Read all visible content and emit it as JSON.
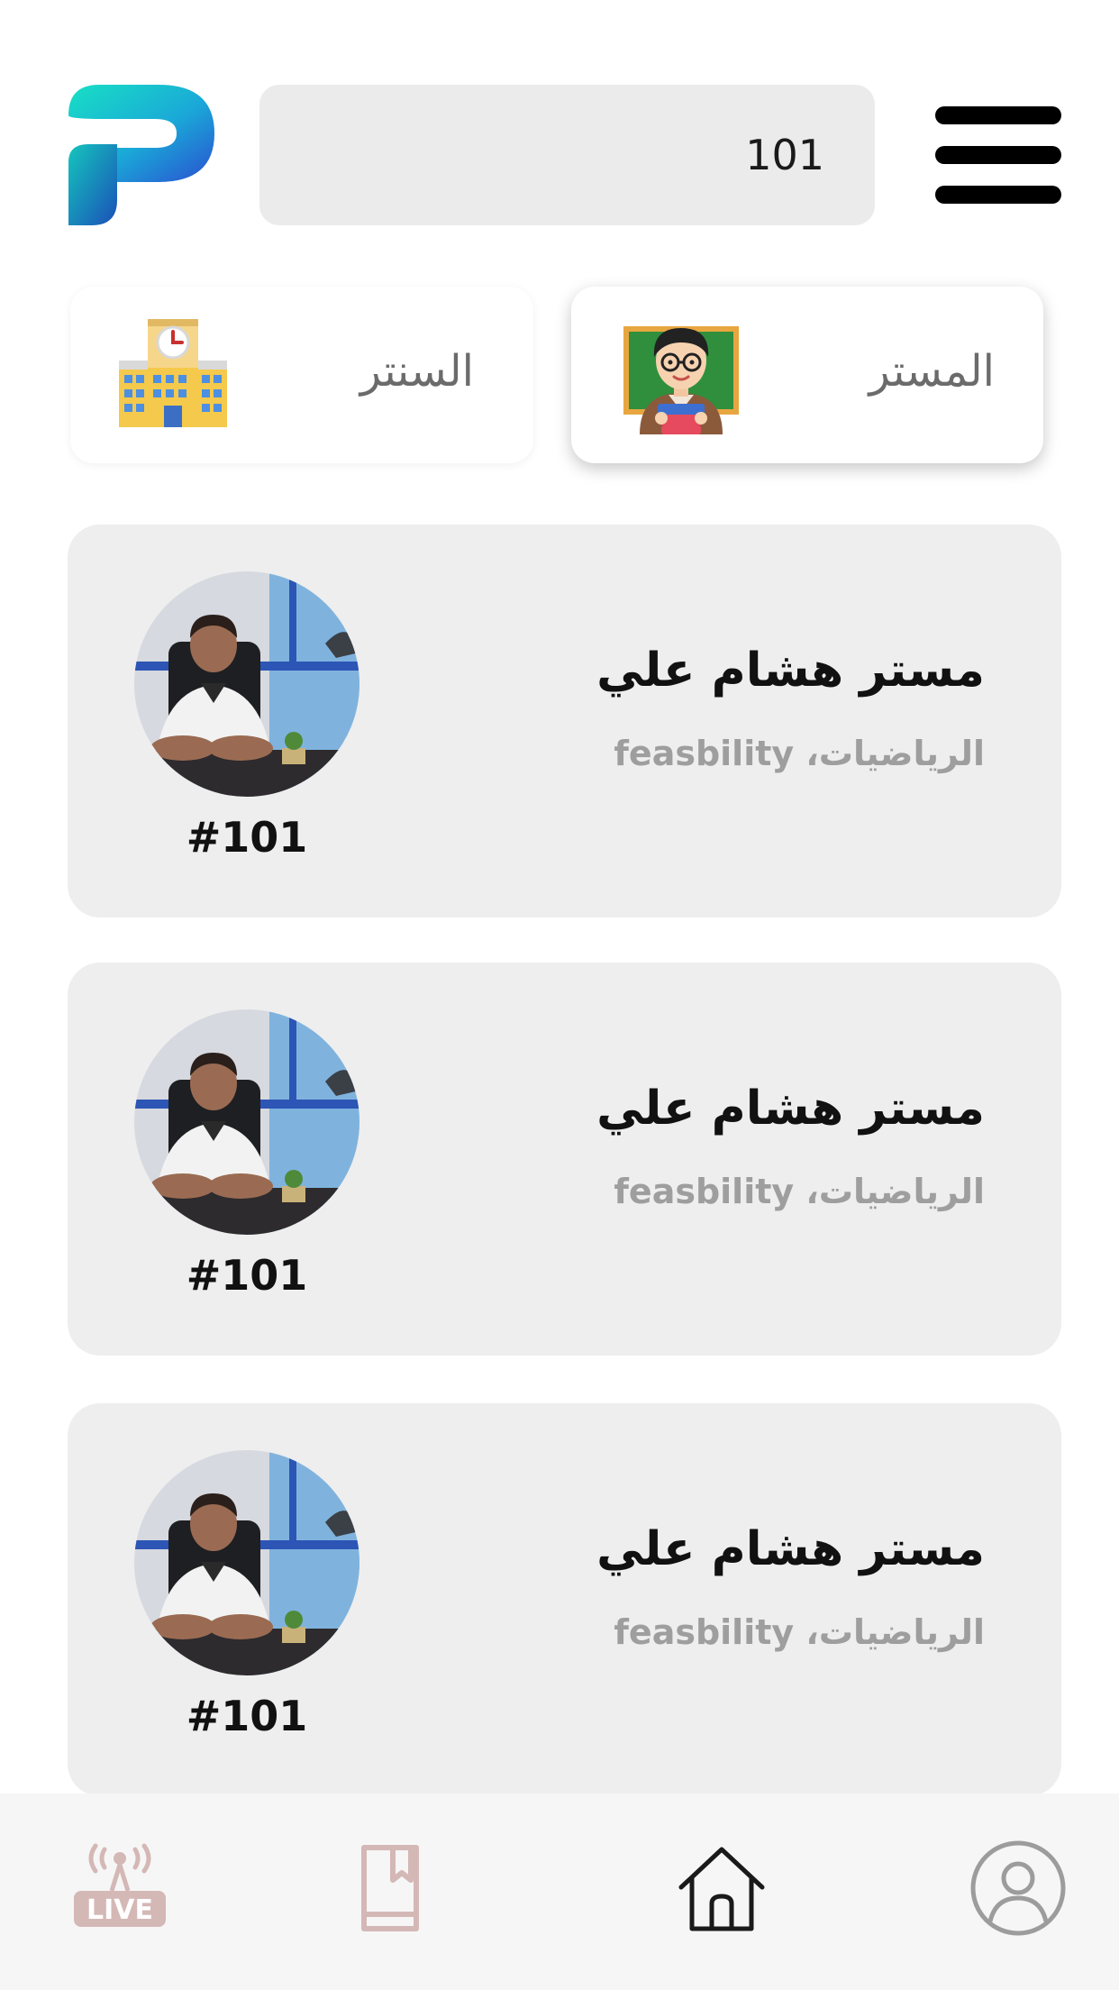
{
  "header": {
    "logo_icon": "app-logo-p",
    "search_value": "101",
    "menu_icon": "hamburger-menu-icon"
  },
  "tabs": [
    {
      "label": "المستر",
      "icon": "teacher-icon",
      "selected": true
    },
    {
      "label": "السنتر",
      "icon": "school-building-icon",
      "selected": false
    }
  ],
  "teachers": [
    {
      "name": "مستر هشام علي",
      "subjects": "الرياضيات، feasbility",
      "code": "#101"
    },
    {
      "name": "مستر هشام علي",
      "subjects": "الرياضيات، feasbility",
      "code": "#101"
    },
    {
      "name": "مستر هشام علي",
      "subjects": "الرياضيات، feasbility",
      "code": "#101"
    }
  ],
  "bottom_nav": {
    "items": [
      "live-icon",
      "bookmark-icon",
      "home-icon",
      "profile-icon"
    ],
    "live_text": "LIVE"
  },
  "colors": {
    "card_bg": "#eeeeee",
    "search_bg": "#ebebeb",
    "nav_bg": "#f6f6f6",
    "muted_icon": "#d4b8b6",
    "logo_teal": "#15d4c0",
    "logo_blue": "#1d5fd6"
  }
}
